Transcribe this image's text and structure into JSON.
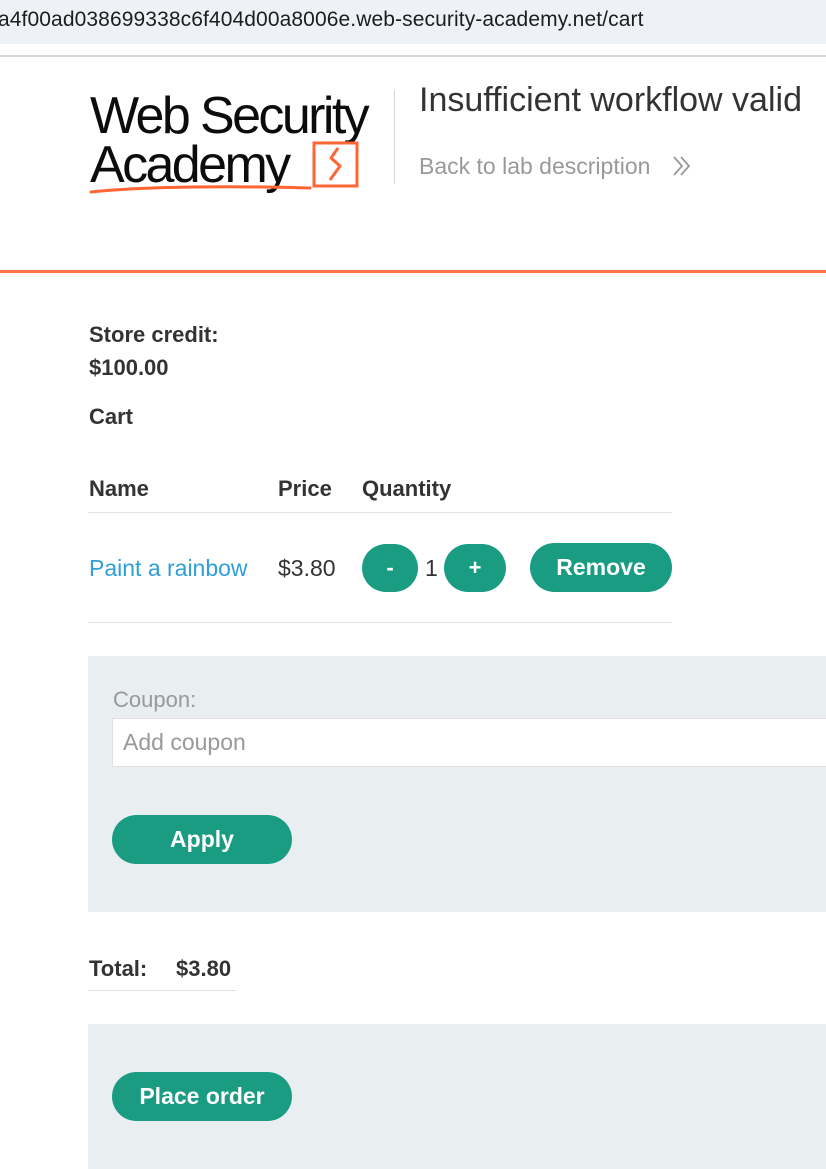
{
  "browser": {
    "url": "a4f00ad038699338c6f404d00a8006e.web-security-academy.net/cart"
  },
  "header": {
    "logo_line1": "Web Security",
    "logo_line2": "Academy",
    "lab_title": "Insufficient workflow valid",
    "back_link": "Back to lab description",
    "accent_color": "#ff6633"
  },
  "account": {
    "store_credit_label": "Store credit:",
    "store_credit_value": "$100.00"
  },
  "cart": {
    "heading": "Cart",
    "columns": [
      "Name",
      "Price",
      "Quantity"
    ],
    "items": [
      {
        "name": "Paint a rainbow",
        "price": "$3.80",
        "quantity": "1",
        "decrease_label": "-",
        "increase_label": "+",
        "remove_label": "Remove"
      }
    ]
  },
  "coupon": {
    "label": "Coupon:",
    "placeholder": "Add coupon",
    "apply_label": "Apply"
  },
  "summary": {
    "total_label": "Total:",
    "total_value": "$3.80"
  },
  "order": {
    "place_order_label": "Place order"
  },
  "colors": {
    "button": "#1a9c82",
    "link": "#2f9fd8",
    "panel": "#e9eef1"
  }
}
